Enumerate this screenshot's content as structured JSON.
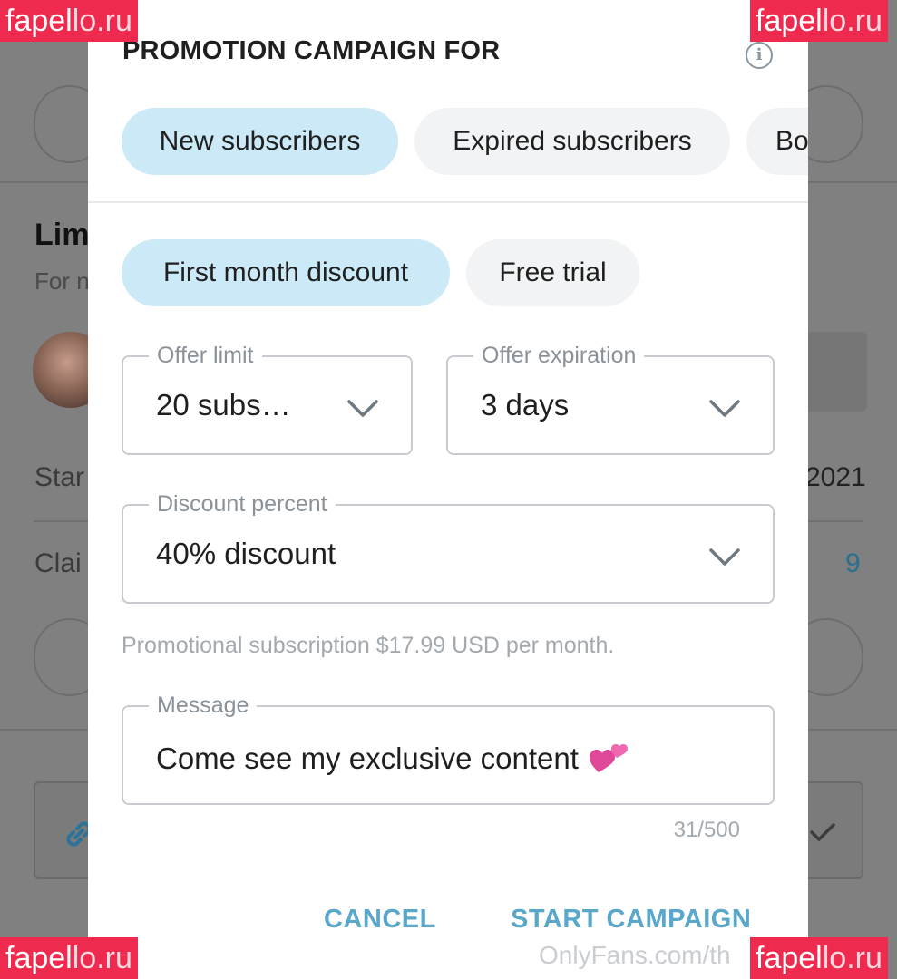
{
  "background": {
    "limited_heading": "Lim",
    "limited_sub": "For n",
    "start_label": "Star",
    "start_value": "2021",
    "claims_label": "Clai",
    "claims_value": "9"
  },
  "modal": {
    "title": "PROMOTION CAMPAIGN FOR",
    "audience_tabs": [
      {
        "label": "New subscribers",
        "active": true
      },
      {
        "label": "Expired subscribers",
        "active": false
      },
      {
        "label": "Bo",
        "active": false
      }
    ],
    "offer_types": [
      {
        "label": "First month discount",
        "active": true
      },
      {
        "label": "Free trial",
        "active": false
      }
    ],
    "offer_limit": {
      "label": "Offer limit",
      "value": "20 subs…"
    },
    "offer_expiration": {
      "label": "Offer expiration",
      "value": "3 days"
    },
    "discount_percent": {
      "label": "Discount percent",
      "value": "40% discount"
    },
    "helper_text": "Promotional subscription $17.99 USD per month.",
    "message": {
      "label": "Message",
      "value": "Come see my exclusive content",
      "emoji": "two-hearts-icon"
    },
    "char_counter": "31/500",
    "cancel_label": "CANCEL",
    "start_label": "START CAMPAIGN"
  },
  "watermark": {
    "text_a": "fapel",
    "text_b": "lo.ru"
  },
  "footer_url": "OnlyFans.com/th",
  "colors": {
    "accent": "#59a7c9",
    "active_chip": "#cbe9f6",
    "inactive_chip": "#f1f3f4",
    "watermark": "#ee2b4f"
  }
}
